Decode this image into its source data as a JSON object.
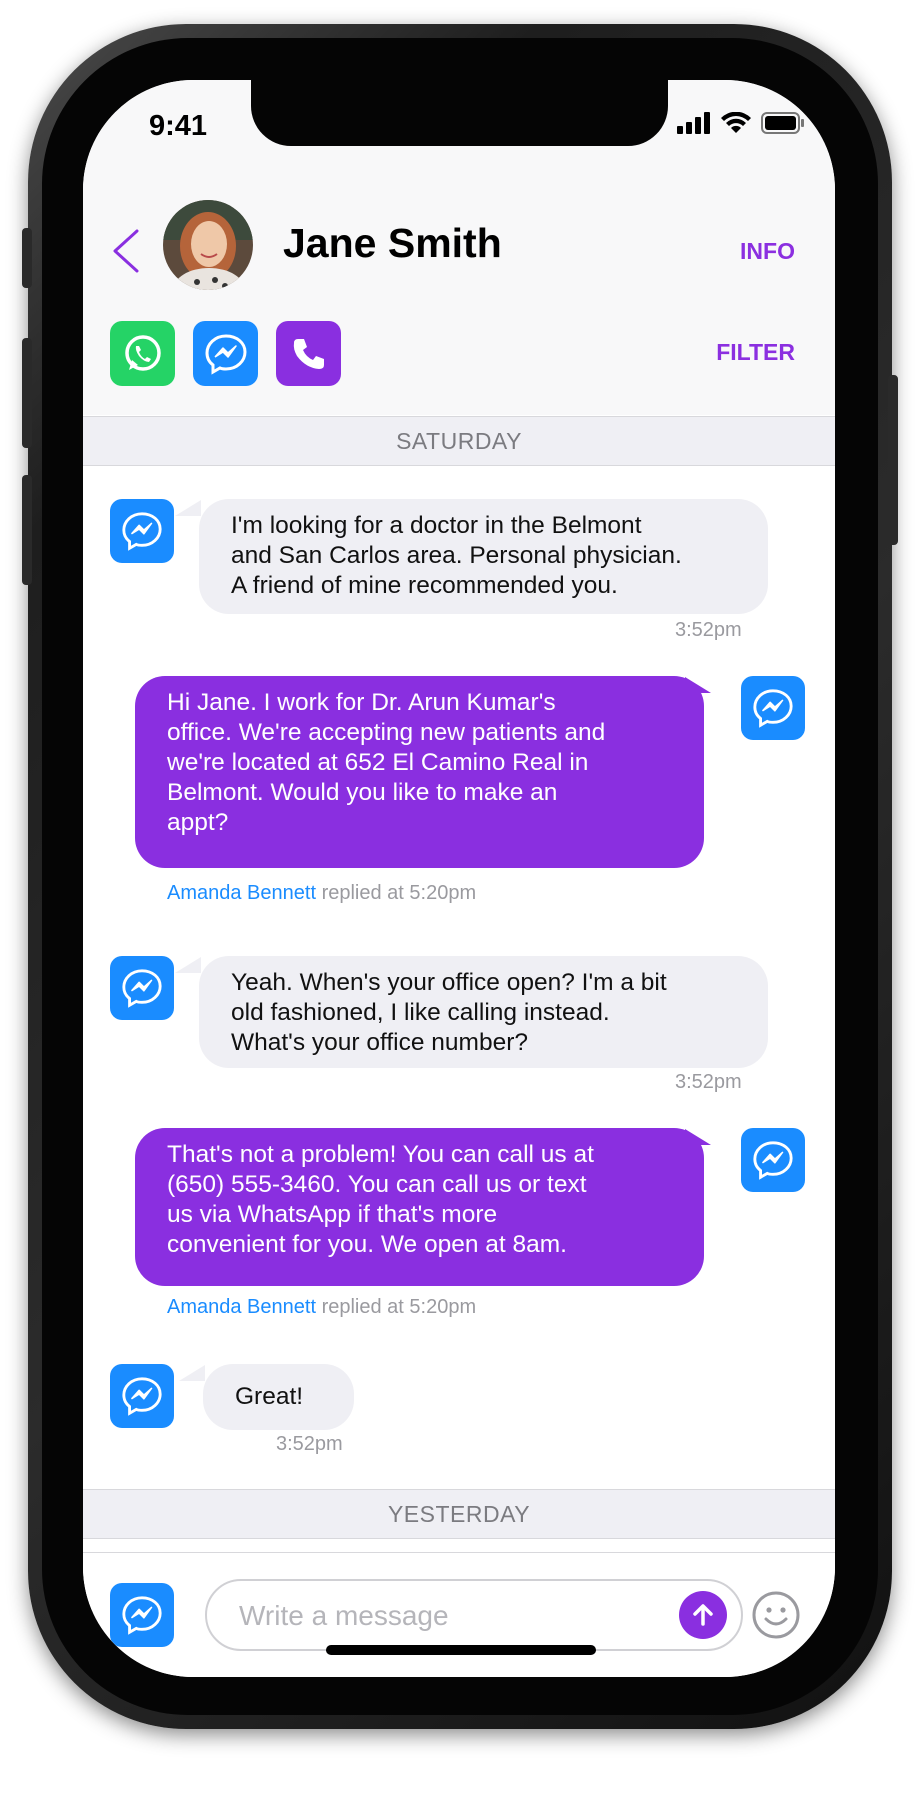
{
  "status_bar": {
    "time": "9:41"
  },
  "header": {
    "contact_name": "Jane Smith",
    "info_label": "INFO",
    "filter_label": "FILTER",
    "channels": [
      "whatsapp",
      "messenger",
      "phone"
    ]
  },
  "days": {
    "saturday": "SATURDAY",
    "yesterday": "YESTERDAY"
  },
  "messages": [
    {
      "direction": "incoming",
      "channel": "messenger",
      "lines": [
        "I'm looking for a doctor in the  Belmont",
        "and San Carlos area. Personal physician.",
        "A friend of mine recommended you."
      ],
      "time": "3:52pm"
    },
    {
      "direction": "outgoing",
      "channel": "messenger",
      "lines": [
        "Hi Jane. I work for Dr. Arun Kumar's",
        "office. We're accepting new patients and",
        "we're located at 652 El Camino Real in",
        "Belmont. Would you like to make an",
        "appt?"
      ],
      "agent": "Amanda Bennett",
      "replied_text": "replied at 5:20pm"
    },
    {
      "direction": "incoming",
      "channel": "messenger",
      "lines": [
        "Yeah. When's your office open? I'm a bit",
        "old fashioned, I like calling instead.",
        "What's your office number?"
      ],
      "time": "3:52pm"
    },
    {
      "direction": "outgoing",
      "channel": "messenger",
      "lines": [
        "That's not a problem! You can call us at",
        "(650) 555-3460. You can call us or text",
        "us via WhatsApp if that's more",
        "convenient for you. We open at 8am."
      ],
      "agent": "Amanda Bennett",
      "replied_text": "replied at 5:20pm"
    },
    {
      "direction": "incoming",
      "channel": "messenger",
      "lines": [
        "Great!"
      ],
      "time": "3:52pm"
    }
  ],
  "composer": {
    "placeholder": "Write a message"
  },
  "colors": {
    "accent": "#8a2fe0",
    "messenger": "#1a8cff",
    "whatsapp": "#25d366",
    "incoming_bubble": "#efeff4"
  },
  "icons": [
    "back-chevron-icon",
    "whatsapp-icon",
    "messenger-icon",
    "phone-icon",
    "send-arrow-icon",
    "emoji-icon",
    "signal-icon",
    "wifi-icon",
    "battery-icon"
  ]
}
